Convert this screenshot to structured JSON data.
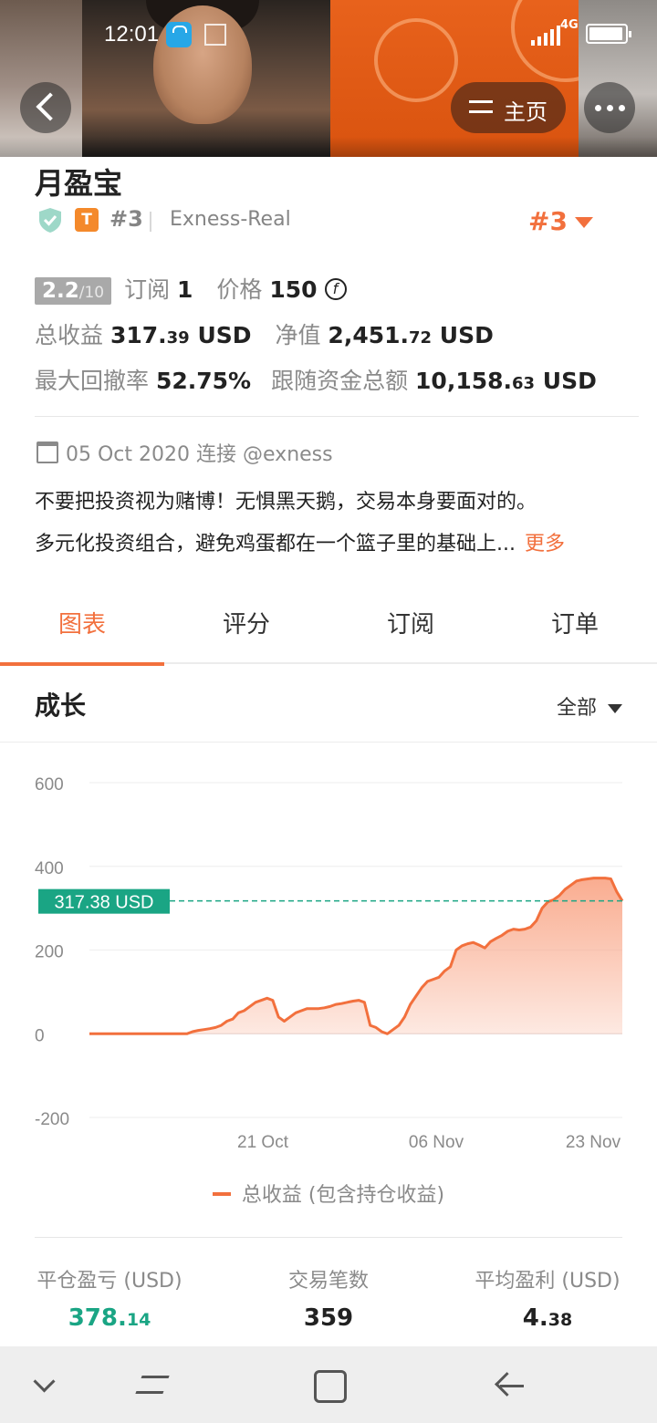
{
  "status_bar": {
    "time": "12:01",
    "network": "4G"
  },
  "header": {
    "home_label": "主页"
  },
  "profile": {
    "title": "月盈宝",
    "tier": "T",
    "rank": "#3",
    "broker": "Exness-Real",
    "rank_right": "#3"
  },
  "stats": {
    "score": "2.2",
    "score_max": "/10",
    "subscribe_label": "订阅",
    "subscribe_value": "1",
    "price_label": "价格",
    "price_value": "150",
    "price_currency": "f",
    "total_profit_label": "总收益",
    "total_profit_int": "317.",
    "total_profit_dec": "39",
    "total_profit_unit": "USD",
    "net_value_label": "净值",
    "net_value_int": "2,451.",
    "net_value_dec": "72",
    "net_value_unit": "USD",
    "max_drawdown_label": "最大回撤率",
    "max_drawdown_value": "52.75%",
    "follow_funds_label": "跟随资金总额",
    "follow_funds_int": "10,158.",
    "follow_funds_dec": "63",
    "follow_funds_unit": "USD"
  },
  "connection": {
    "date": "05 Oct 2020",
    "label": "连接",
    "handle": "@exness"
  },
  "description": {
    "line1": "不要把投资视为赌博！无惧黑天鹅，交易本身要面对的。",
    "line2": "多元化投资组合，避免鸡蛋都在一个篮子里的基础上...",
    "more": "更多"
  },
  "tabs": [
    {
      "label": "图表",
      "active": true
    },
    {
      "label": "评分"
    },
    {
      "label": "订阅"
    },
    {
      "label": "订单"
    }
  ],
  "section": {
    "title": "成长",
    "range": "全部"
  },
  "chart_data": {
    "type": "area",
    "y_ticks": [
      "600",
      "400",
      "200",
      "0",
      "-200"
    ],
    "ylim": [
      -200,
      600
    ],
    "x_ticks": [
      "21 Oct",
      "06 Nov",
      "23 Nov"
    ],
    "current_label": "317.38 USD",
    "current_value": 317.38,
    "legend": "总收益 (包含持仓收益)",
    "colors": {
      "line": "#f2703d",
      "fill": "#f9a88a",
      "current": "#1aa584"
    },
    "series": [
      {
        "name": "总收益 (包含持仓收益)",
        "values": [
          0,
          0,
          0,
          0,
          0,
          0,
          0,
          0,
          0,
          0,
          0,
          0,
          0,
          0,
          0,
          0,
          0,
          0,
          5,
          8,
          10,
          12,
          15,
          20,
          30,
          35,
          50,
          55,
          65,
          75,
          80,
          85,
          80,
          40,
          30,
          40,
          50,
          55,
          60,
          60,
          60,
          62,
          65,
          70,
          72,
          75,
          78,
          80,
          75,
          20,
          15,
          5,
          0,
          10,
          20,
          40,
          70,
          90,
          110,
          125,
          130,
          135,
          150,
          160,
          200,
          210,
          215,
          218,
          212,
          205,
          220,
          228,
          235,
          245,
          250,
          248,
          250,
          255,
          270,
          300,
          315,
          320,
          330,
          345,
          355,
          365,
          368,
          370,
          372,
          372,
          372,
          370,
          340,
          317.38
        ]
      }
    ]
  },
  "summary": [
    {
      "label": "平仓盈亏 (USD)",
      "int": "378.",
      "dec": "14",
      "color": "green"
    },
    {
      "label": "交易笔数",
      "int": "359",
      "dec": ""
    },
    {
      "label": "平均盈利 (USD)",
      "int": "4.",
      "dec": "38"
    }
  ]
}
